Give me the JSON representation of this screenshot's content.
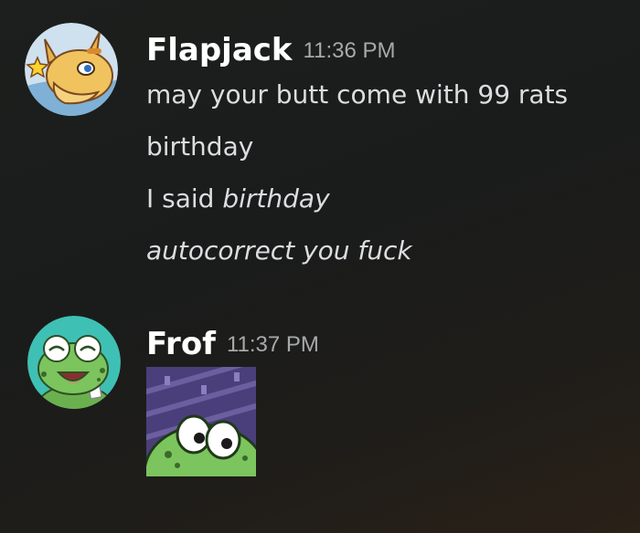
{
  "messages": [
    {
      "author": "Flapjack",
      "time": "11:36 PM",
      "lines": [
        {
          "plain": "may your butt come with 99 rats",
          "italic": ""
        },
        {
          "plain": "birthday",
          "italic": ""
        },
        {
          "plain": "I said ",
          "italic": "birthday"
        },
        {
          "plain": "",
          "italic": "autocorrect you fuck"
        }
      ]
    },
    {
      "author": "Frof",
      "time": "11:37 PM"
    }
  ],
  "icons": {
    "flapjack_avatar": "dragon-avatar-icon",
    "frof_avatar": "frog-avatar-icon",
    "attachment": "frog-sticker-image"
  },
  "colors": {
    "username": "#ffffff",
    "timestamp": "#a7a9ac",
    "message_text": "#dcdde0",
    "background": "#1c1f1d"
  }
}
